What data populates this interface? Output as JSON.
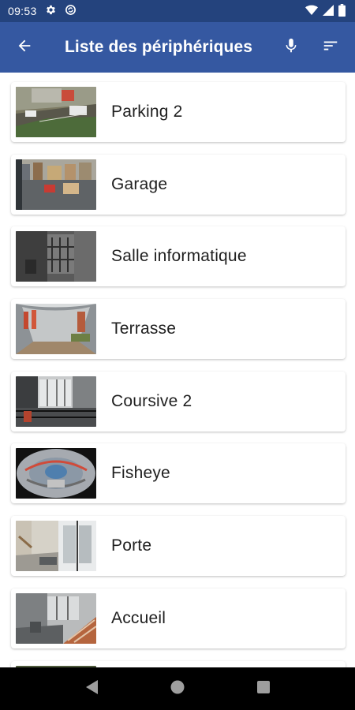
{
  "status_bar": {
    "time": "09:53",
    "icons": [
      "settings-gear-icon",
      "sync-icon",
      "wifi-icon",
      "signal-icon",
      "battery-icon"
    ]
  },
  "app_bar": {
    "title": "Liste des périphériques",
    "back_icon": "arrow-left-icon",
    "mic_icon": "microphone-icon",
    "sort_icon": "sort-icon"
  },
  "devices": [
    {
      "name": "Parking 2",
      "thumb": "parking"
    },
    {
      "name": "Garage",
      "thumb": "garage"
    },
    {
      "name": "Salle informatique",
      "thumb": "server-room"
    },
    {
      "name": "Terrasse",
      "thumb": "terrace"
    },
    {
      "name": "Coursive 2",
      "thumb": "corridor"
    },
    {
      "name": "Fisheye",
      "thumb": "fisheye"
    },
    {
      "name": "Porte",
      "thumb": "door"
    },
    {
      "name": "Accueil",
      "thumb": "reception"
    }
  ],
  "nav_bar": {
    "back": "nav-back-icon",
    "home": "nav-home-icon",
    "recents": "nav-recents-icon"
  },
  "colors": {
    "status_bar": "#24437d",
    "app_bar": "#3558a1",
    "text": "#1f1f1f"
  }
}
